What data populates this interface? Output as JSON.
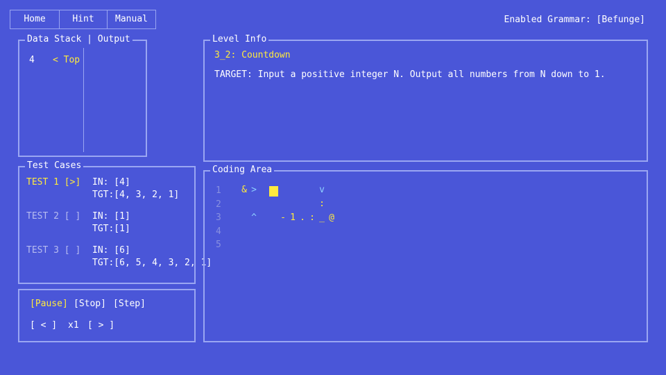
{
  "nav": {
    "home": "Home",
    "hint": "Hint",
    "manual": "Manual",
    "grammar": "Enabled Grammar: [Befunge]"
  },
  "stack_panel": {
    "title": "Data Stack | Output",
    "stack_value": "4",
    "top_label": "< Top"
  },
  "level": {
    "title": "Level Info",
    "name": "3_2: Countdown",
    "target": "TARGET: Input a positive integer N. Output all numbers from N down to 1."
  },
  "tests": {
    "title": "Test Cases",
    "items": [
      {
        "label": "TEST 1 [>]",
        "input": "IN: [4]",
        "target": "TGT:[4, 3, 2, 1]"
      },
      {
        "label": "TEST 2 [ ]",
        "input": "IN: [1]",
        "target": "TGT:[1]"
      },
      {
        "label": "TEST 3 [ ]",
        "input": "IN: [6]",
        "target": "TGT:[6, 5, 4, 3, 2, 1]"
      }
    ]
  },
  "controls": {
    "pause": "[Pause]",
    "stop": "[Stop]",
    "step": "[Step]",
    "slower": "[ < ]",
    "speed": "x1",
    "faster": "[ > ]"
  },
  "coding": {
    "title": "Coding Area",
    "line_numbers": [
      "1",
      "2",
      "3",
      "4",
      "5"
    ],
    "line1": {
      "amp": "&",
      "arrow": ">",
      "down": "v"
    },
    "line2": {
      "dup": ":"
    },
    "line3": {
      "up": "^",
      "minus": "-",
      "one": "1",
      "dot": ".",
      "colon": ":",
      "under": "_",
      "at": "@"
    }
  },
  "colors": {
    "background": "#4a56d8",
    "border": "#9aa6f2",
    "highlight": "#ffea3d",
    "accent": "#8ed0ff"
  }
}
